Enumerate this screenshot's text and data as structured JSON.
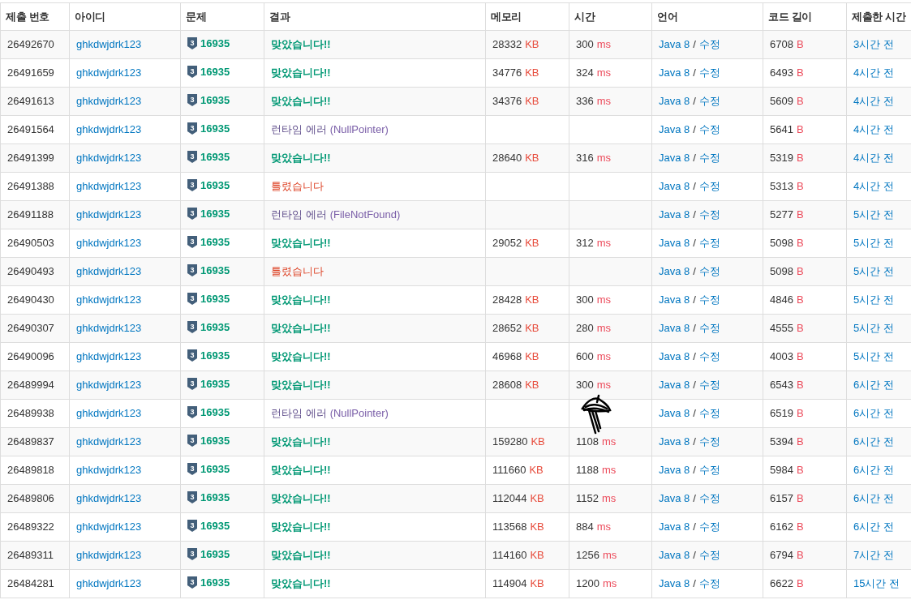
{
  "columns": [
    "제출 번호",
    "아이디",
    "문제",
    "결과",
    "메모리",
    "시간",
    "언어",
    "코드 길이",
    "제출한 시간"
  ],
  "rows": [
    {
      "id": "26492670",
      "user": "ghkdwjdrk123",
      "tier": "3",
      "problem": "16935",
      "result": {
        "kind": "ac",
        "text": "맞았습니다!!"
      },
      "memory": "28332",
      "memory_unit": "KB",
      "time": "300",
      "time_unit": "ms",
      "language": "Java 8",
      "sep": "/",
      "edit": "수정",
      "length": "6708",
      "length_unit": "B",
      "submitted": "3시간 전"
    },
    {
      "id": "26491659",
      "user": "ghkdwjdrk123",
      "tier": "3",
      "problem": "16935",
      "result": {
        "kind": "ac",
        "text": "맞았습니다!!"
      },
      "memory": "34776",
      "memory_unit": "KB",
      "time": "324",
      "time_unit": "ms",
      "language": "Java 8",
      "sep": "/",
      "edit": "수정",
      "length": "6493",
      "length_unit": "B",
      "submitted": "4시간 전"
    },
    {
      "id": "26491613",
      "user": "ghkdwjdrk123",
      "tier": "3",
      "problem": "16935",
      "result": {
        "kind": "ac",
        "text": "맞았습니다!!"
      },
      "memory": "34376",
      "memory_unit": "KB",
      "time": "336",
      "time_unit": "ms",
      "language": "Java 8",
      "sep": "/",
      "edit": "수정",
      "length": "5609",
      "length_unit": "B",
      "submitted": "4시간 전"
    },
    {
      "id": "26491564",
      "user": "ghkdwjdrk123",
      "tier": "3",
      "problem": "16935",
      "result": {
        "kind": "rte",
        "text": "런타임 에러",
        "detail": "(NullPointer)"
      },
      "language": "Java 8",
      "sep": "/",
      "edit": "수정",
      "length": "5641",
      "length_unit": "B",
      "submitted": "4시간 전"
    },
    {
      "id": "26491399",
      "user": "ghkdwjdrk123",
      "tier": "3",
      "problem": "16935",
      "result": {
        "kind": "ac",
        "text": "맞았습니다!!"
      },
      "memory": "28640",
      "memory_unit": "KB",
      "time": "316",
      "time_unit": "ms",
      "language": "Java 8",
      "sep": "/",
      "edit": "수정",
      "length": "5319",
      "length_unit": "B",
      "submitted": "4시간 전"
    },
    {
      "id": "26491388",
      "user": "ghkdwjdrk123",
      "tier": "3",
      "problem": "16935",
      "result": {
        "kind": "wa",
        "text": "틀렸습니다"
      },
      "language": "Java 8",
      "sep": "/",
      "edit": "수정",
      "length": "5313",
      "length_unit": "B",
      "submitted": "4시간 전"
    },
    {
      "id": "26491188",
      "user": "ghkdwjdrk123",
      "tier": "3",
      "problem": "16935",
      "result": {
        "kind": "rte",
        "text": "런타임 에러",
        "detail": "(FileNotFound)"
      },
      "language": "Java 8",
      "sep": "/",
      "edit": "수정",
      "length": "5277",
      "length_unit": "B",
      "submitted": "5시간 전"
    },
    {
      "id": "26490503",
      "user": "ghkdwjdrk123",
      "tier": "3",
      "problem": "16935",
      "result": {
        "kind": "ac",
        "text": "맞았습니다!!"
      },
      "memory": "29052",
      "memory_unit": "KB",
      "time": "312",
      "time_unit": "ms",
      "language": "Java 8",
      "sep": "/",
      "edit": "수정",
      "length": "5098",
      "length_unit": "B",
      "submitted": "5시간 전"
    },
    {
      "id": "26490493",
      "user": "ghkdwjdrk123",
      "tier": "3",
      "problem": "16935",
      "result": {
        "kind": "wa",
        "text": "틀렸습니다"
      },
      "language": "Java 8",
      "sep": "/",
      "edit": "수정",
      "length": "5098",
      "length_unit": "B",
      "submitted": "5시간 전"
    },
    {
      "id": "26490430",
      "user": "ghkdwjdrk123",
      "tier": "3",
      "problem": "16935",
      "result": {
        "kind": "ac",
        "text": "맞았습니다!!"
      },
      "memory": "28428",
      "memory_unit": "KB",
      "time": "300",
      "time_unit": "ms",
      "language": "Java 8",
      "sep": "/",
      "edit": "수정",
      "length": "4846",
      "length_unit": "B",
      "submitted": "5시간 전"
    },
    {
      "id": "26490307",
      "user": "ghkdwjdrk123",
      "tier": "3",
      "problem": "16935",
      "result": {
        "kind": "ac",
        "text": "맞았습니다!!"
      },
      "memory": "28652",
      "memory_unit": "KB",
      "time": "280",
      "time_unit": "ms",
      "language": "Java 8",
      "sep": "/",
      "edit": "수정",
      "length": "4555",
      "length_unit": "B",
      "submitted": "5시간 전"
    },
    {
      "id": "26490096",
      "user": "ghkdwjdrk123",
      "tier": "3",
      "problem": "16935",
      "result": {
        "kind": "ac",
        "text": "맞았습니다!!"
      },
      "memory": "46968",
      "memory_unit": "KB",
      "time": "600",
      "time_unit": "ms",
      "language": "Java 8",
      "sep": "/",
      "edit": "수정",
      "length": "4003",
      "length_unit": "B",
      "submitted": "5시간 전"
    },
    {
      "id": "26489994",
      "user": "ghkdwjdrk123",
      "tier": "3",
      "problem": "16935",
      "result": {
        "kind": "ac",
        "text": "맞았습니다!!"
      },
      "memory": "28608",
      "memory_unit": "KB",
      "time": "300",
      "time_unit": "ms",
      "language": "Java 8",
      "sep": "/",
      "edit": "수정",
      "length": "6543",
      "length_unit": "B",
      "submitted": "6시간 전"
    },
    {
      "id": "26489938",
      "user": "ghkdwjdrk123",
      "tier": "3",
      "problem": "16935",
      "result": {
        "kind": "rte",
        "text": "런타임 에러",
        "detail": "(NullPointer)"
      },
      "language": "Java 8",
      "sep": "/",
      "edit": "수정",
      "length": "6519",
      "length_unit": "B",
      "submitted": "6시간 전"
    },
    {
      "id": "26489837",
      "user": "ghkdwjdrk123",
      "tier": "3",
      "problem": "16935",
      "result": {
        "kind": "ac",
        "text": "맞았습니다!!"
      },
      "memory": "159280",
      "memory_unit": "KB",
      "time": "1108",
      "time_unit": "ms",
      "language": "Java 8",
      "sep": "/",
      "edit": "수정",
      "length": "5394",
      "length_unit": "B",
      "submitted": "6시간 전"
    },
    {
      "id": "26489818",
      "user": "ghkdwjdrk123",
      "tier": "3",
      "problem": "16935",
      "result": {
        "kind": "ac",
        "text": "맞았습니다!!"
      },
      "memory": "111660",
      "memory_unit": "KB",
      "time": "1188",
      "time_unit": "ms",
      "language": "Java 8",
      "sep": "/",
      "edit": "수정",
      "length": "5984",
      "length_unit": "B",
      "submitted": "6시간 전"
    },
    {
      "id": "26489806",
      "user": "ghkdwjdrk123",
      "tier": "3",
      "problem": "16935",
      "result": {
        "kind": "ac",
        "text": "맞았습니다!!"
      },
      "memory": "112044",
      "memory_unit": "KB",
      "time": "1152",
      "time_unit": "ms",
      "language": "Java 8",
      "sep": "/",
      "edit": "수정",
      "length": "6157",
      "length_unit": "B",
      "submitted": "6시간 전"
    },
    {
      "id": "26489322",
      "user": "ghkdwjdrk123",
      "tier": "3",
      "problem": "16935",
      "result": {
        "kind": "ac",
        "text": "맞았습니다!!"
      },
      "memory": "113568",
      "memory_unit": "KB",
      "time": "884",
      "time_unit": "ms",
      "language": "Java 8",
      "sep": "/",
      "edit": "수정",
      "length": "6162",
      "length_unit": "B",
      "submitted": "6시간 전"
    },
    {
      "id": "26489311",
      "user": "ghkdwjdrk123",
      "tier": "3",
      "problem": "16935",
      "result": {
        "kind": "ac",
        "text": "맞았습니다!!"
      },
      "memory": "114160",
      "memory_unit": "KB",
      "time": "1256",
      "time_unit": "ms",
      "language": "Java 8",
      "sep": "/",
      "edit": "수정",
      "length": "6794",
      "length_unit": "B",
      "submitted": "7시간 전"
    },
    {
      "id": "26484281",
      "user": "ghkdwjdrk123",
      "tier": "3",
      "problem": "16935",
      "result": {
        "kind": "ac",
        "text": "맞았습니다!!"
      },
      "memory": "114904",
      "memory_unit": "KB",
      "time": "1200",
      "time_unit": "ms",
      "language": "Java 8",
      "sep": "/",
      "edit": "수정",
      "length": "6622",
      "length_unit": "B",
      "submitted": "15시간 전"
    }
  ]
}
